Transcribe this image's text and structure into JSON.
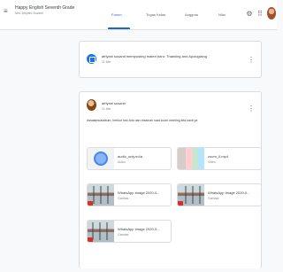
{
  "header": {
    "class_title": "Happy English Seventh Grade",
    "class_subtitle": "Mrs. Afriyani Susanti",
    "tabs": [
      {
        "label": "Forum",
        "active": true
      },
      {
        "label": "Tugas Kelas",
        "active": false
      },
      {
        "label": "Anggota",
        "active": false
      },
      {
        "label": "Nilai",
        "active": false
      }
    ],
    "icons": {
      "menu": "hamburger-menu-icon",
      "settings": "gear-icon",
      "apps": "apps-grid-icon"
    }
  },
  "stream": {
    "announcement": {
      "text": "afriyani susanti memposting materi baru: Thanking and Apologizing",
      "date": "11 Mei"
    },
    "post": {
      "author": "afriyani susanti",
      "date": "11 Mei",
      "body": "Assalamualaikum, berikut foto-foto dan rekaman saat zoom meeting kita nanti ya",
      "attachments": [
        {
          "title": "audio_only.m4a",
          "type": "Audio",
          "thumb": "audio"
        },
        {
          "title": "zoom_0.mp4",
          "type": "Video",
          "thumb": "video"
        },
        {
          "title": "WhatsApp Image 2020-0...",
          "type": "Gambar",
          "thumb": "photo"
        },
        {
          "title": "WhatsApp Image 2020-0...",
          "type": "Gambar",
          "thumb": "photo"
        },
        {
          "title": "WhatsApp Image 2020-0...",
          "type": "Gambar",
          "thumb": "photo"
        }
      ]
    }
  },
  "colors": {
    "accent": "#1967d2",
    "classwork_icon": "#1a73e8",
    "border": "#dadce0"
  }
}
